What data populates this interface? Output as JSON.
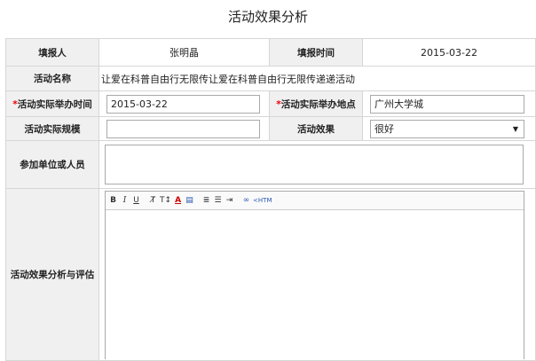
{
  "page": {
    "title": "活动效果分析"
  },
  "form": {
    "reporter_label": "填报人",
    "reporter_value": "张明晶",
    "report_time_label": "填报时间",
    "report_time_value": "2015-03-22",
    "activity_name_label": "活动名称",
    "activity_name_value": "让爱在科普自由行无限传让爱在科普自由行无限传递递活动",
    "actual_time_label": "活动实际举办时间",
    "actual_time_value": "2015-03-22",
    "actual_place_label": "活动实际举办地点",
    "actual_place_value": "广州大学城",
    "scale_label": "活动实际规模",
    "scale_value": "",
    "effect_label": "活动效果",
    "effect_value": "很好",
    "participants_label": "参加单位或人员",
    "participants_value": "",
    "analysis_label": "活动效果分析与评估"
  },
  "editor": {
    "toolbar": {
      "bold": "B",
      "italic": "I",
      "underline": "U",
      "clear_format": "T̸",
      "font_size": "T↕",
      "font_color": "A",
      "bg_color": "▤",
      "ordered_list": "≣",
      "unordered_list": "☰",
      "indent": "⇥",
      "link": "∞",
      "html": "<HTM"
    }
  }
}
